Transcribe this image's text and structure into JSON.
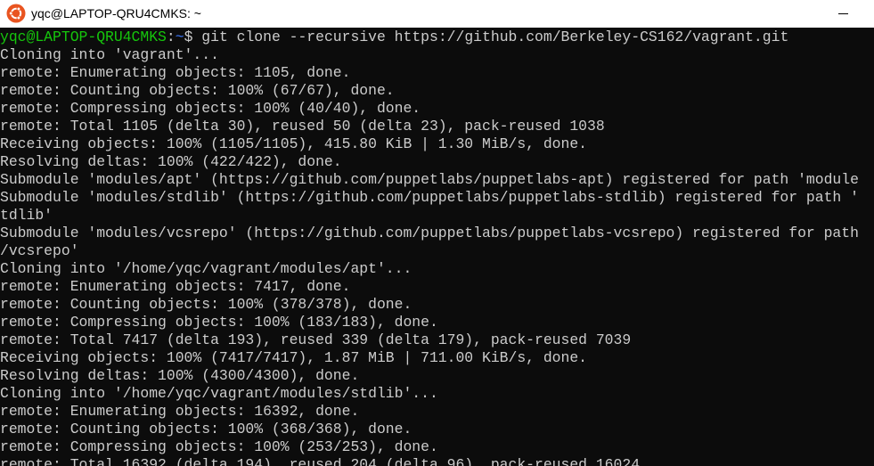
{
  "window": {
    "title": "yqc@LAPTOP-QRU4CMKS: ~",
    "app_icon": "ubuntu-icon",
    "controls": [
      "minimize-icon"
    ]
  },
  "colors": {
    "background": "#0c0c0c",
    "text": "#cccccc",
    "prompt_user": "#16c60c",
    "prompt_path": "#3b78ff",
    "ubuntu_orange": "#e95420"
  },
  "prompt": {
    "user_host": "yqc@LAPTOP-QRU4CMKS",
    "colon": ":",
    "path": "~",
    "symbol": "$ ",
    "command": "git clone --recursive https://github.com/Berkeley-CS162/vagrant.git"
  },
  "lines": [
    "Cloning into 'vagrant'...",
    "remote: Enumerating objects: 1105, done.",
    "remote: Counting objects: 100% (67/67), done.",
    "remote: Compressing objects: 100% (40/40), done.",
    "remote: Total 1105 (delta 30), reused 50 (delta 23), pack-reused 1038",
    "Receiving objects: 100% (1105/1105), 415.80 KiB | 1.30 MiB/s, done.",
    "Resolving deltas: 100% (422/422), done.",
    "Submodule 'modules/apt' (https://github.com/puppetlabs/puppetlabs-apt) registered for path 'module",
    "Submodule 'modules/stdlib' (https://github.com/puppetlabs/puppetlabs-stdlib) registered for path '",
    "tdlib'",
    "Submodule 'modules/vcsrepo' (https://github.com/puppetlabs/puppetlabs-vcsrepo) registered for path",
    "/vcsrepo'",
    "Cloning into '/home/yqc/vagrant/modules/apt'...",
    "remote: Enumerating objects: 7417, done.",
    "remote: Counting objects: 100% (378/378), done.",
    "remote: Compressing objects: 100% (183/183), done.",
    "remote: Total 7417 (delta 193), reused 339 (delta 179), pack-reused 7039",
    "Receiving objects: 100% (7417/7417), 1.87 MiB | 711.00 KiB/s, done.",
    "Resolving deltas: 100% (4300/4300), done.",
    "Cloning into '/home/yqc/vagrant/modules/stdlib'...",
    "remote: Enumerating objects: 16392, done.",
    "remote: Counting objects: 100% (368/368), done.",
    "remote: Compressing objects: 100% (253/253), done.",
    "remote: Total 16392 (delta 194), reused 204 (delta 96), pack-reused 16024"
  ]
}
